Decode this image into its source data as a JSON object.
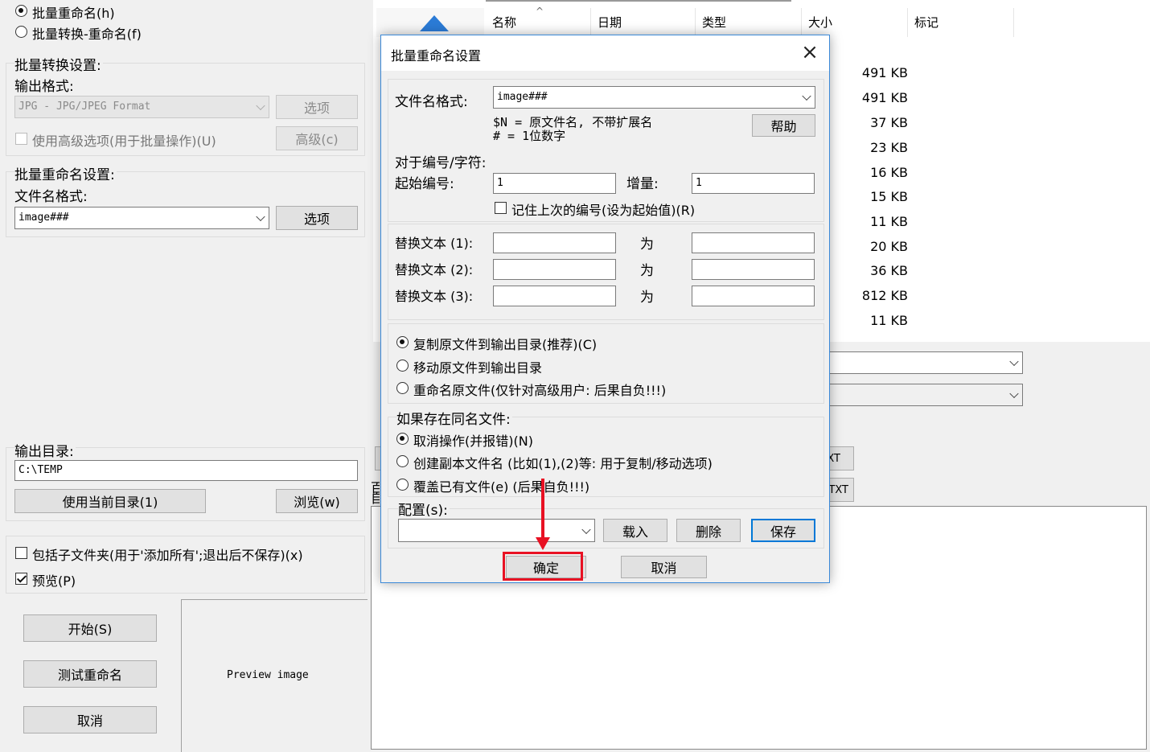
{
  "left": {
    "rename_mode_radio": "批量重命名(h)",
    "convert_rename_radio": "批量转换-重命名(f)",
    "convert_settings_label": "批量转换设置:",
    "output_format_label": "输出格式:",
    "output_format_value": "JPG - JPG/JPEG Format",
    "options_button": "选项",
    "advanced_checkbox": "使用高级选项(用于批量操作)(U)",
    "advanced_button": "高级(c)",
    "rename_settings_label": "批量重命名设置:",
    "filename_format_label": "文件名格式:",
    "filename_format_value": "image###",
    "rename_options_button": "选项",
    "output_dir_label": "输出目录:",
    "output_dir_value": "C:\\TEMP",
    "use_current_dir_button": "使用当前目录(1)",
    "browse_button": "浏览(w)",
    "include_subfolders_checkbox": "包括子文件夹(用于'添加所有';退出后不保存)(x)",
    "preview_checkbox": "预览(P)",
    "start_button": "开始(S)",
    "test_rename_button": "测试重命名",
    "cancel_button": "取消",
    "preview_text": "Preview image"
  },
  "file_list": {
    "columns": [
      "名称",
      "日期",
      "类型",
      "大小",
      "标记"
    ],
    "sizes": [
      "491 KB",
      "491 KB",
      "37 KB",
      "23 KB",
      "16 KB",
      "15 KB",
      "11 KB",
      "20 KB",
      "36 KB",
      "812 KB",
      "11 KB"
    ],
    "partial_btn1": "XT",
    "partial_btn2": "TXT",
    "partial_label": "百",
    "partial_label2": "自"
  },
  "dialog": {
    "title": "批量重命名设置",
    "filename_format_label": "文件名格式:",
    "filename_format_value": "image###",
    "hint_line1": "$N = 原文件名, 不带扩展名",
    "hint_line2": "#  = 1位数字",
    "help_button": "帮助",
    "numbering_label": "对于编号/字符:",
    "start_number_label": "起始编号:",
    "start_number_value": "1",
    "increment_label": "增量:",
    "increment_value": "1",
    "remember_checkbox": "记住上次的编号(设为起始值)(R)",
    "replace1_label": "替换文本 (1):",
    "replace2_label": "替换文本 (2):",
    "replace3_label": "替换文本 (3):",
    "as_label": "为",
    "copy_radio": "复制原文件到输出目录(推荐)(C)",
    "move_radio": "移动原文件到输出目录",
    "rename_original_radio": "重命名原文件(仅针对高级用户: 后果自负!!!)",
    "exists_label": "如果存在同名文件:",
    "cancel_op_radio": "取消操作(并报错)(N)",
    "create_copy_radio": "创建副本文件名 (比如(1),(2)等: 用于复制/移动选项)",
    "overwrite_radio": "覆盖已有文件(e) (后果自负!!!)",
    "config_label": "配置(s):",
    "load_button": "载入",
    "delete_button": "删除",
    "save_button": "保存",
    "ok_button": "确定",
    "cancel_button": "取消"
  },
  "colors": {
    "highlight_red": "#e81123",
    "focus_blue": "#0078d7",
    "dialog_border": "#3c8ad9"
  }
}
